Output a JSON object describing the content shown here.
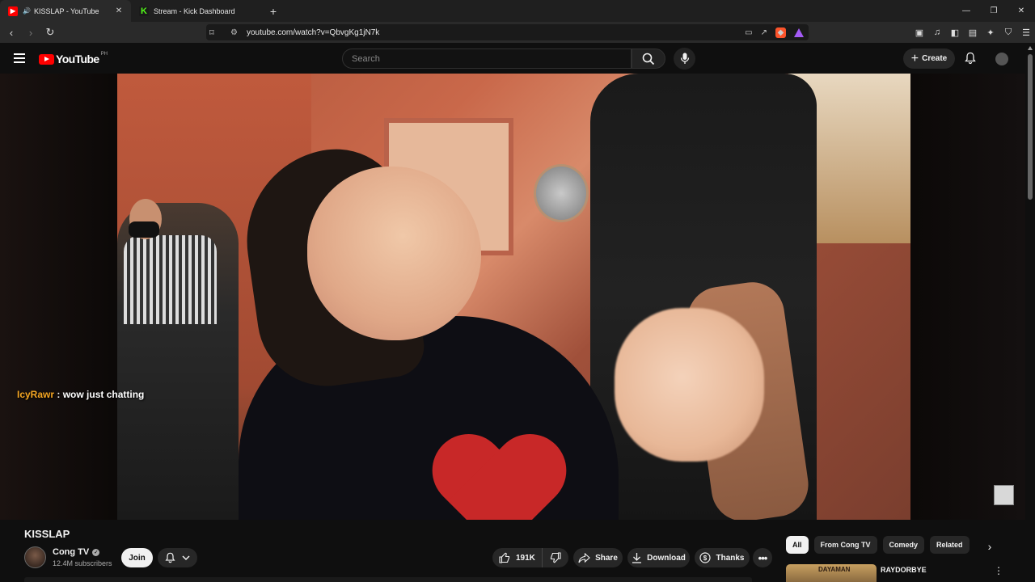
{
  "browser": {
    "tabs": [
      {
        "title": "KISSLAP - YouTube",
        "favicon": "youtube-icon",
        "active": true
      },
      {
        "title": "Stream - Kick Dashboard",
        "favicon": "kick-icon",
        "active": false
      }
    ],
    "new_tab": "+",
    "url": "youtube.com/watch?v=QbvgKg1jN7k"
  },
  "masthead": {
    "logo_text": "YouTube",
    "country_code": "PH",
    "search_placeholder": "Search",
    "create_label": "Create"
  },
  "chat_overlay": {
    "username": "IcyRawr",
    "message": ": wow just chatting"
  },
  "video": {
    "title": "KISSLAP",
    "channel": {
      "name": "Cong TV",
      "subscribers": "12.4M subscribers",
      "verified": true
    },
    "join_label": "Join",
    "likes": "191K",
    "share_label": "Share",
    "download_label": "Download",
    "thanks_label": "Thanks",
    "more_label": "•••"
  },
  "sidebar": {
    "chips": [
      "All",
      "From Cong TV",
      "Comedy",
      "Related"
    ],
    "active_chip": "All",
    "recommendation": {
      "title": "RAYDORBYE",
      "thumb_text": "DAYAMAN"
    }
  },
  "colors": {
    "youtube_red": "#ff0000",
    "kick_green": "#53fc18",
    "chat_username": "#f5a623",
    "background": "#0f0f0f"
  }
}
